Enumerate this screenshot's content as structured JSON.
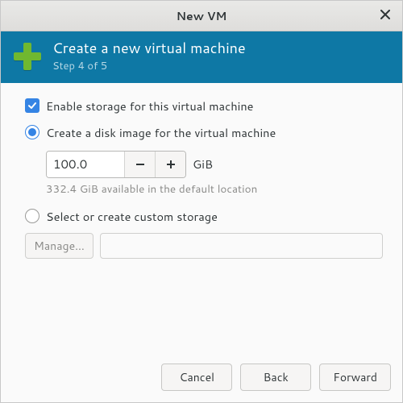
{
  "window": {
    "title": "New VM"
  },
  "header": {
    "title": "Create a new virtual machine",
    "subtitle": "Step 4 of 5"
  },
  "storage": {
    "enable_label": "Enable storage for this virtual machine",
    "enable_checked": true,
    "create_disk_label": "Create a disk image for the virtual machine",
    "create_disk_selected": true,
    "size_value": "100.0",
    "size_unit": "GiB",
    "available_hint": "332.4 GiB available in the default location",
    "custom_label": "Select or create custom storage",
    "custom_selected": false,
    "manage_label": "Manage...",
    "path_value": ""
  },
  "footer": {
    "cancel": "Cancel",
    "back": "Back",
    "forward": "Forward"
  },
  "colors": {
    "accent": "#3584e4",
    "band": "#0e78a5",
    "plus": "#70b830"
  }
}
